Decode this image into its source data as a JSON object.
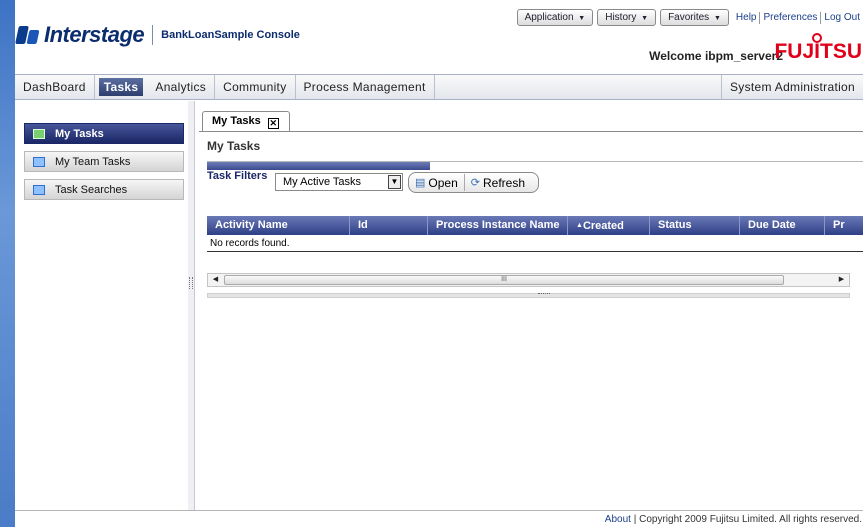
{
  "header": {
    "logo_text": "Interstage",
    "console_title": "BankLoanSample Console",
    "welcome": "Welcome ibpm_server2",
    "brand": "FUJITSU",
    "menus": [
      {
        "label": "Application"
      },
      {
        "label": "History"
      },
      {
        "label": "Favorites"
      }
    ],
    "links": {
      "help": "Help",
      "preferences": "Preferences",
      "logout": "Log Out"
    }
  },
  "nav": {
    "items": [
      "DashBoard",
      "Tasks",
      "Analytics",
      "Community",
      "Process Management"
    ],
    "active": "Tasks",
    "right_item": "System Administration"
  },
  "sidebar": {
    "items": [
      {
        "label": "My Tasks",
        "active": true
      },
      {
        "label": "My Team Tasks",
        "active": false
      },
      {
        "label": "Task Searches",
        "active": false
      }
    ]
  },
  "main": {
    "tab_label": "My Tasks",
    "page_title": "My Tasks",
    "filters_label": "Task Filters",
    "filter_value": "My Active Tasks",
    "open_label": "Open",
    "refresh_label": "Refresh",
    "table": {
      "columns": [
        "Activity Name",
        "Id",
        "Process Instance Name",
        "Created",
        "Status",
        "Due Date",
        "Pr"
      ],
      "sort_indicator": "▲",
      "empty_message": "No records found."
    },
    "scrollbar_thumb": "III"
  },
  "footer": {
    "about": "About",
    "separator": "|",
    "copyright": "Copyright 2009 Fujitsu Limited. All rights reserved."
  },
  "colors": {
    "accent_dark": "#1b2766",
    "brand_red": "#e0001b",
    "background_blue": "#4a7cc7"
  }
}
